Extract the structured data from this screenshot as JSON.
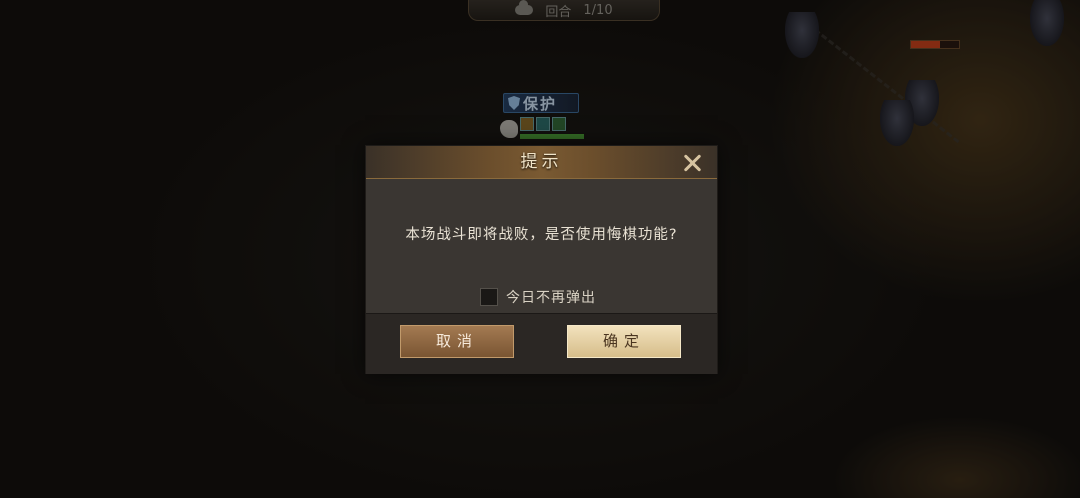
{
  "hud": {
    "round_label": "回合",
    "round_count": "1/10",
    "weather_icon": "cloud-icon"
  },
  "unit_tag": {
    "status_label": "保护",
    "icon": "shield-icon",
    "hp_fraction": 1.0
  },
  "enemy_unit": {
    "hp_fraction": 0.6
  },
  "dialog": {
    "title": "提示",
    "message": "本场战斗即将战败，是否使用悔棋功能?",
    "dont_show_label": "今日不再弹出",
    "dont_show_checked": false,
    "cancel_label": "取消",
    "confirm_label": "确定",
    "close_icon": "close-icon"
  },
  "colors": {
    "dialog_bg": "#3a3632",
    "header_accent": "#7a5a32",
    "cancel_button": "#8f6841",
    "confirm_button": "#e6d2a4",
    "protect_blue": "#3f6d9a"
  }
}
